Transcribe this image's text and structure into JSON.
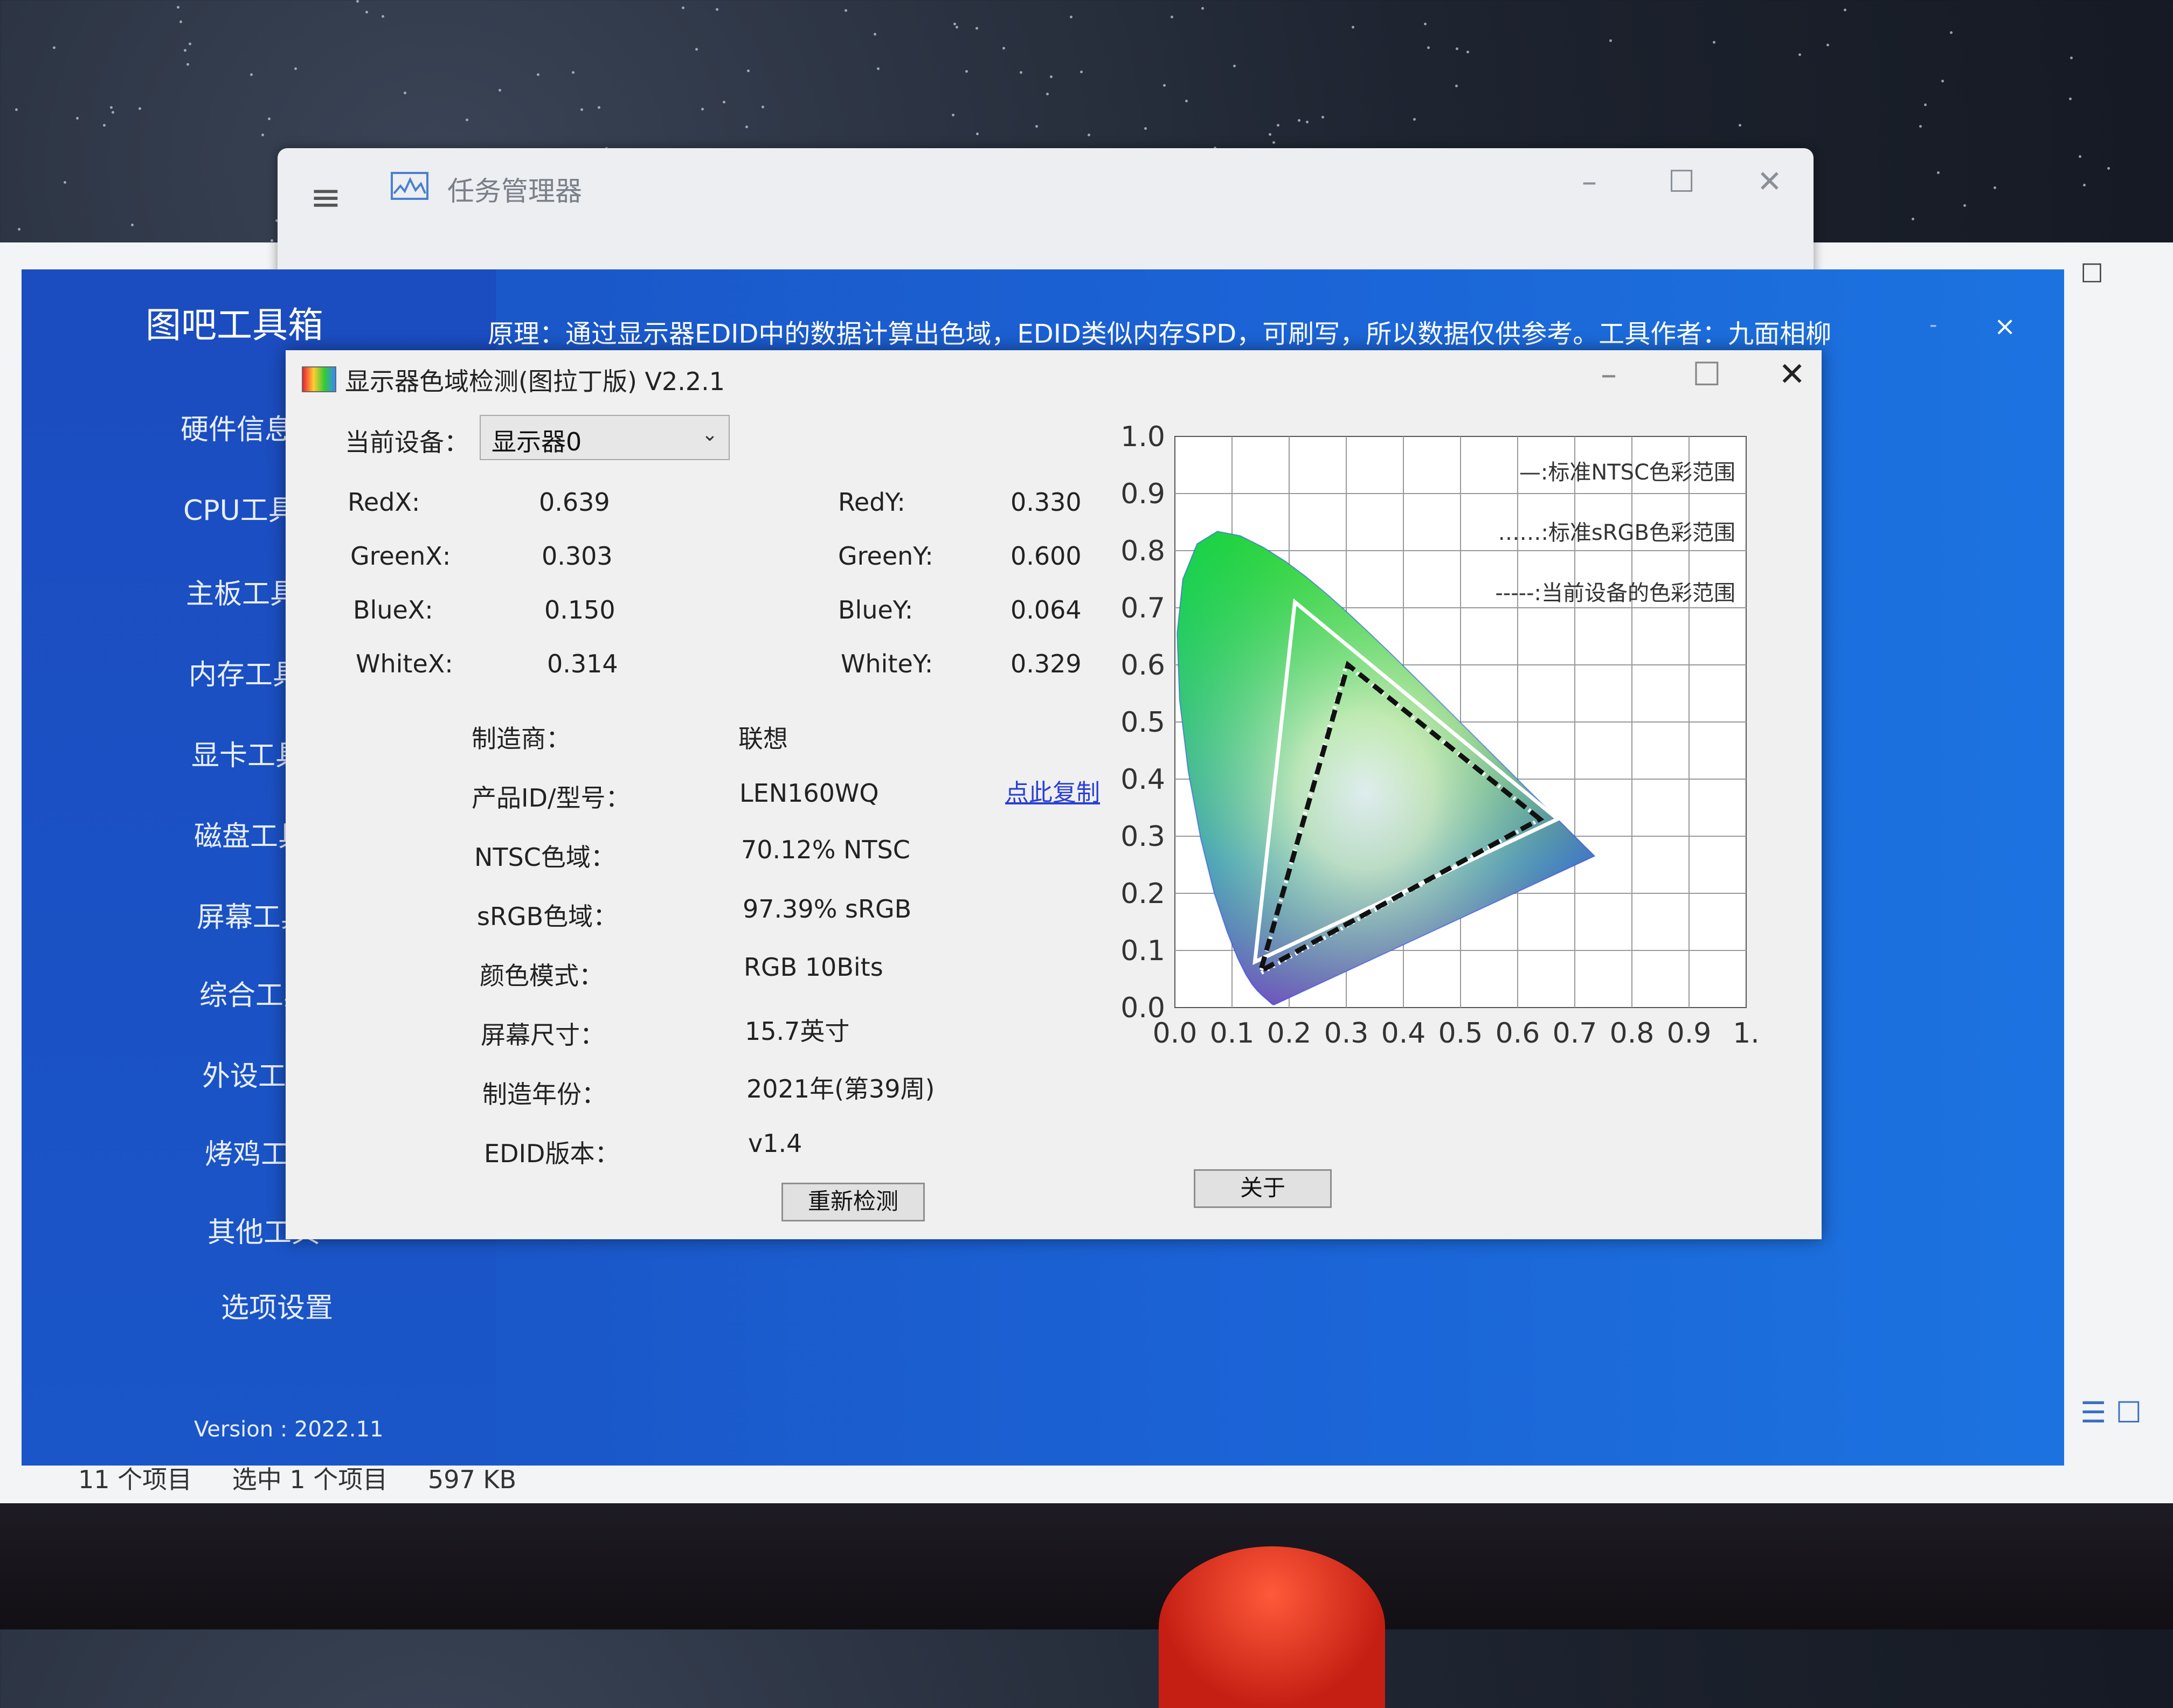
{
  "task_manager": {
    "title": "任务管理器",
    "menu_icon": "hamburger-icon",
    "controls": {
      "minimize": "–",
      "maximize": "☐",
      "close": "✕"
    }
  },
  "explorer": {
    "status_items": "11 个项目",
    "status_selected": "选中 1 个项目",
    "status_size": "597 KB",
    "maximize": "☐"
  },
  "toolbox": {
    "app_title": "图吧工具箱",
    "banner": "原理：通过显示器EDID中的数据计算出色域，EDID类似内存SPD，可刷写，所以数据仅供参考。工具作者：九面相柳",
    "minimize": "-",
    "close": "×",
    "version": "Version : 2022.11",
    "nav": [
      "硬件信息",
      "CPU工具",
      "主板工具",
      "内存工具",
      "显卡工具",
      "磁盘工具",
      "屏幕工具",
      "综合工具",
      "外设工具",
      "烤鸡工具",
      "其他工具",
      "选项设置"
    ]
  },
  "dialog": {
    "title": "显示器色域检测(图拉丁版) V2.2.1",
    "controls": {
      "minimize": "–",
      "maximize": "☐",
      "close": "✕"
    },
    "device_label": "当前设备：",
    "device_value": "显示器0",
    "coords": {
      "red_x_label": "RedX:",
      "red_x": "0.639",
      "red_y_label": "RedY:",
      "red_y": "0.330",
      "green_x_label": "GreenX:",
      "green_x": "0.303",
      "green_y_label": "GreenY:",
      "green_y": "0.600",
      "blue_x_label": "BlueX:",
      "blue_x": "0.150",
      "blue_y_label": "BlueY:",
      "blue_y": "0.064",
      "white_x_label": "WhiteX:",
      "white_x": "0.314",
      "white_y_label": "WhiteY:",
      "white_y": "0.329"
    },
    "info": [
      {
        "label": "制造商：",
        "value": "联想"
      },
      {
        "label": "产品ID/型号：",
        "value": "LEN160WQ"
      },
      {
        "label": "NTSC色域：",
        "value": "70.12% NTSC"
      },
      {
        "label": "sRGB色域：",
        "value": "97.39% sRGB"
      },
      {
        "label": "颜色模式：",
        "value": "RGB 10Bits"
      },
      {
        "label": "屏幕尺寸：",
        "value": "15.7英寸"
      },
      {
        "label": "制造年份：",
        "value": "2021年(第39周)"
      },
      {
        "label": "EDID版本：",
        "value": "v1.4"
      }
    ],
    "copy_link": "点此复制",
    "redetect_button": "重新检测",
    "about_button": "关于"
  },
  "chart_data": {
    "type": "scatter",
    "title": "",
    "xlabel": "",
    "ylabel": "",
    "xlim": [
      0,
      1
    ],
    "ylim": [
      0,
      1
    ],
    "x_ticks": [
      "0.0",
      "0.1",
      "0.2",
      "0.3",
      "0.4",
      "0.5",
      "0.6",
      "0.7",
      "0.8",
      "0.9",
      "1."
    ],
    "y_ticks": [
      "0.0",
      "0.1",
      "0.2",
      "0.3",
      "0.4",
      "0.5",
      "0.6",
      "0.7",
      "0.8",
      "0.9",
      "1.0"
    ],
    "grid": true,
    "legend_position": "top-right",
    "series": [
      {
        "name": "—:标准NTSC色彩范围",
        "style": "solid",
        "color": "#ffffff",
        "points": [
          [
            0.67,
            0.33
          ],
          [
            0.21,
            0.71
          ],
          [
            0.14,
            0.08
          ]
        ]
      },
      {
        "name": "……:标准sRGB色彩范围",
        "style": "dotted",
        "color": "#ffffff",
        "points": [
          [
            0.64,
            0.33
          ],
          [
            0.3,
            0.6
          ],
          [
            0.15,
            0.06
          ]
        ]
      },
      {
        "name": "-----:当前设备的色彩范围",
        "style": "dashed",
        "color": "#111111",
        "points": [
          [
            0.639,
            0.33
          ],
          [
            0.303,
            0.6
          ],
          [
            0.15,
            0.064
          ]
        ]
      }
    ]
  }
}
